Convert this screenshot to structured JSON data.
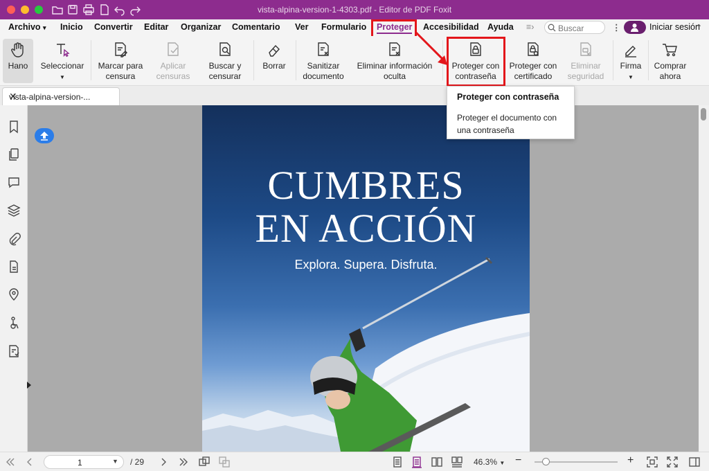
{
  "window": {
    "title": "vista-alpina-version-1-4303.pdf - Editor de PDF Foxit"
  },
  "menu": {
    "items": [
      "Archivo",
      "Inicio",
      "Convertir",
      "Editar",
      "Organizar",
      "Comentario",
      "Ver",
      "Formulario",
      "Proteger",
      "Accesibilidad",
      "Ayuda"
    ],
    "active": "Proteger",
    "search_placeholder": "Buscar",
    "signin_label": "Iniciar sesión"
  },
  "ribbon": {
    "hand": "Hano",
    "select": "Seleccionar",
    "mark_redact_1": "Marcar para",
    "mark_redact_2": "censura",
    "apply_redact_1": "Aplicar",
    "apply_redact_2": "censuras",
    "search_redact_1": "Buscar y",
    "search_redact_2": "censurar",
    "erase": "Borrar",
    "sanitize_1": "Sanitizar",
    "sanitize_2": "documento",
    "remove_hidden_1": "Eliminar información",
    "remove_hidden_2": "oculta",
    "protect_password_1": "Proteger con",
    "protect_password_2": "contraseña",
    "protect_cert_1": "Proteger con",
    "protect_cert_2": "certificado",
    "remove_security_1": "Eliminar",
    "remove_security_2": "seguridad",
    "sign": "Firma",
    "buy_1": "Comprar",
    "buy_2": "ahora"
  },
  "tooltip": {
    "title": "Proteger con contraseña",
    "description": "Proteger el documento con una contraseña"
  },
  "tab": {
    "label": "vista-alpina-version-..."
  },
  "document": {
    "cover_title_line1": "CUMBRES",
    "cover_title_line2": "EN ACCIÓN",
    "cover_subtitle": "Explora. Supera. Disfruta."
  },
  "status": {
    "current_page": "1",
    "total_pages": "/ 29",
    "zoom": "46.3%",
    "zoom_fraction": 0.13
  },
  "colors": {
    "brand": "#8d2c8e",
    "highlight": "#e3161b"
  }
}
